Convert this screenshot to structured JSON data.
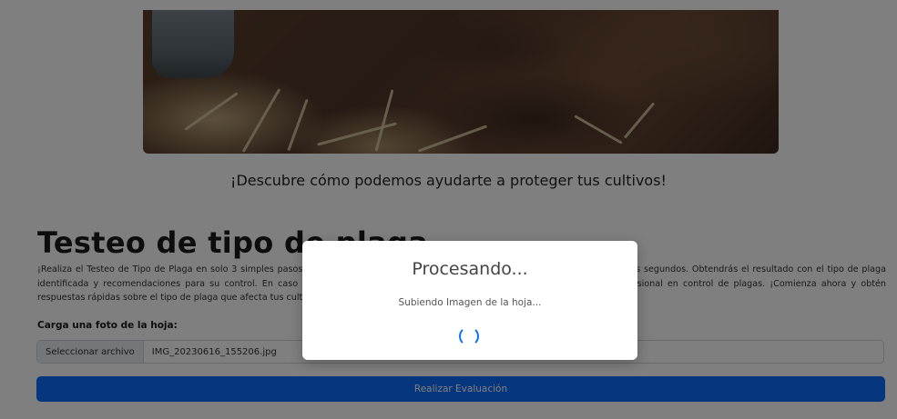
{
  "hero": {
    "tagline": "¡Descubre cómo podemos ayudarte a proteger tus cultivos!"
  },
  "section": {
    "title": "Testeo de tipo de plaga",
    "description": "¡Realiza el Testeo de Tipo de Plaga en solo 3 simples pasos. Carga una foto de la hoja, haz clic en \"Realizar Evaluación\" y espera unos segundos. Obtendrás el resultado con el tipo de plaga identificada y recomendaciones para su control. En caso de duda o plagas complejas, se recomienda buscar asesoramiento profesional en control de plagas. ¡Comienza ahora y obtén respuestas rápidas sobre el tipo de plaga que afecta tus cultivos!"
  },
  "upload": {
    "label": "Carga una foto de la hoja:",
    "button_label": "Seleccionar archivo",
    "file_name": "IMG_20230616_155206.jpg"
  },
  "submit": {
    "label": "Realizar Evaluación"
  },
  "modal": {
    "title": "Procesando...",
    "message": "Subiendo Imagen de la hoja..."
  },
  "colors": {
    "primary": "#0d6efd"
  }
}
